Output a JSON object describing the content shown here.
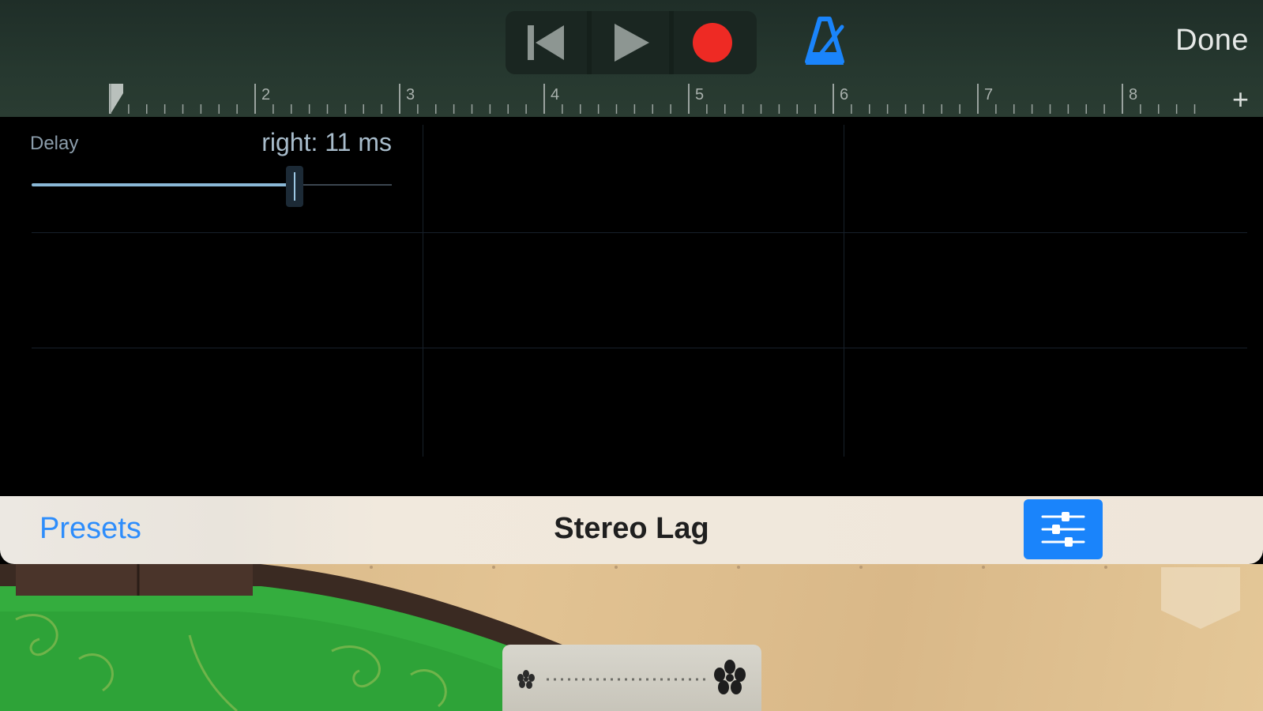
{
  "topbar": {
    "transport": {
      "rewind_icon": "rewind-to-start-icon",
      "play_icon": "play-icon",
      "record_icon": "record-icon",
      "record_color": "#ee2a24"
    },
    "metronome_icon": "metronome-icon",
    "metronome_color": "#1a84fb",
    "done_label": "Done"
  },
  "ruler": {
    "bar_numbers": [
      "2",
      "3",
      "4",
      "5",
      "6",
      "7",
      "8"
    ],
    "add_label": "+"
  },
  "editor": {
    "parameter_name": "Delay",
    "parameter_value": "right: 11 ms",
    "slider_fraction": 0.73
  },
  "presetbar": {
    "presets_label": "Presets",
    "preset_name": "Stereo Lag",
    "settings_icon": "sliders-icon",
    "accent_color": "#1a84fb"
  },
  "instrument": {
    "panel_icon_left": "small-flower-icon",
    "panel_icon_right": "large-flower-icon"
  }
}
